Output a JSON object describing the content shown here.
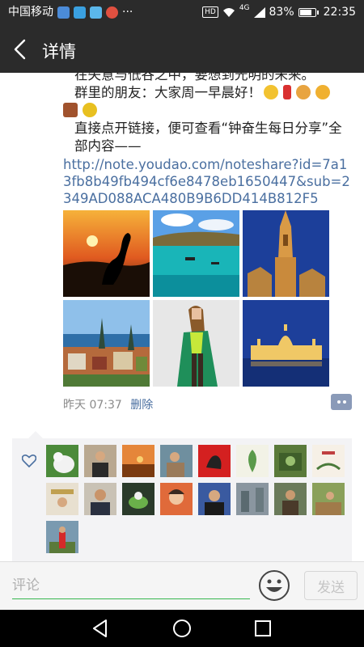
{
  "status_bar": {
    "carrier": "中国移动",
    "dots": "···",
    "hd": "HD",
    "network": "4G",
    "battery": "83%",
    "battery_level": 0.83,
    "time": "22:35"
  },
  "header": {
    "title": "详情"
  },
  "post": {
    "cut_line": "在失意与低谷之中，要想到光明的未来。",
    "greeting": "群里的朋友：大家周一早晨好！",
    "intro": "直接点开链接，便可查看“钟奋生每日分享”全部内容——",
    "link": "http://note.youdao.com/noteshare?id=7a13fb8b49fb494cf6e8478eb1650447&sub=2349AD088ACA480B9B6DD414B812F5",
    "time": "昨天 07:37",
    "delete": "删除"
  },
  "input": {
    "placeholder": "评论",
    "send": "发送"
  },
  "colors": {
    "accent": "#37b74f",
    "link": "#4a6fa0",
    "bar": "#2b2b2b"
  }
}
